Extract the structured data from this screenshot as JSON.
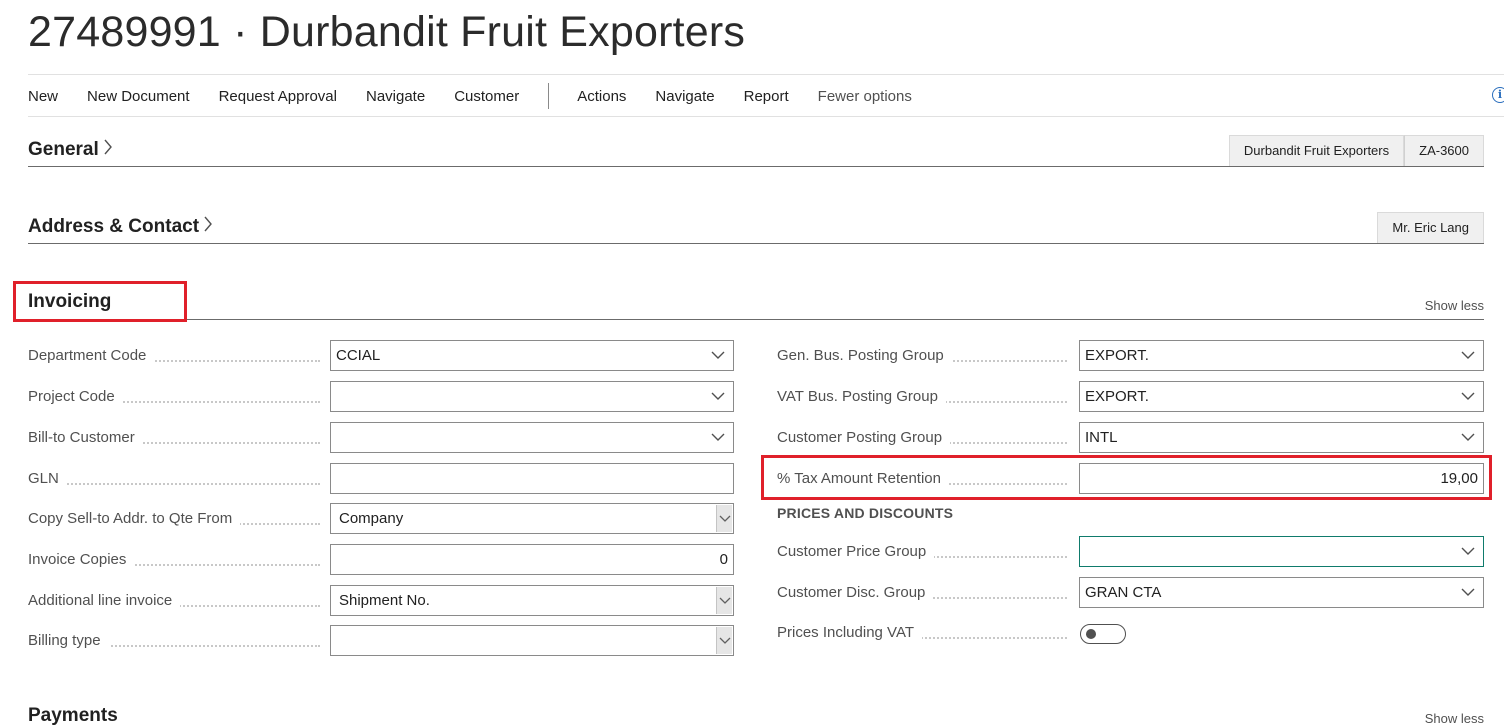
{
  "page": {
    "title": "27489991 · Durbandit Fruit Exporters"
  },
  "actions": [
    {
      "id": "new",
      "label": "New"
    },
    {
      "id": "new-document",
      "label": "New Document"
    },
    {
      "id": "request-approval",
      "label": "Request Approval"
    },
    {
      "id": "navigate",
      "label": "Navigate"
    },
    {
      "id": "customer",
      "label": "Customer"
    },
    {
      "id": "actions",
      "label": "Actions"
    },
    {
      "id": "navigate-2",
      "label": "Navigate"
    },
    {
      "id": "report",
      "label": "Report"
    },
    {
      "id": "fewer-options",
      "label": "Fewer options"
    }
  ],
  "sections": {
    "general": {
      "title": "General",
      "badges": [
        "Durbandit Fruit Exporters",
        "ZA-3600"
      ]
    },
    "address": {
      "title": "Address & Contact",
      "badges": [
        "Mr. Eric Lang"
      ]
    },
    "invoicing": {
      "title": "Invoicing",
      "show_less": "Show less"
    },
    "payments": {
      "title": "Payments",
      "show_less": "Show less"
    }
  },
  "invoicing": {
    "left": [
      {
        "label": "Department Code",
        "value": "CCIAL",
        "kind": "dropdown"
      },
      {
        "label": "Project Code",
        "value": "",
        "kind": "dropdown"
      },
      {
        "label": "Bill-to Customer",
        "value": "",
        "kind": "dropdown"
      },
      {
        "label": "GLN",
        "value": "",
        "kind": "text"
      },
      {
        "label": "Copy Sell-to Addr. to Qte From",
        "value": "Company",
        "kind": "select"
      },
      {
        "label": "Invoice Copies",
        "value": "0",
        "kind": "number"
      },
      {
        "label": "Additional line invoice",
        "value": "Shipment No.",
        "kind": "select"
      },
      {
        "label": "Billing type",
        "value": "",
        "kind": "select"
      }
    ],
    "right": [
      {
        "label": "Gen. Bus. Posting Group",
        "value": "EXPORT.",
        "kind": "dropdown"
      },
      {
        "label": "VAT Bus. Posting Group",
        "value": "EXPORT.",
        "kind": "dropdown"
      },
      {
        "label": "Customer Posting Group",
        "value": "INTL",
        "kind": "dropdown"
      },
      {
        "label": "% Tax Amount Retention",
        "value": "19,00",
        "kind": "number"
      }
    ],
    "prices_heading": "PRICES AND DISCOUNTS",
    "prices": [
      {
        "label": "Customer Price Group",
        "value": "",
        "kind": "dropdown"
      },
      {
        "label": "Customer Disc. Group",
        "value": "GRAN CTA",
        "kind": "dropdown"
      },
      {
        "label": "Prices Including VAT",
        "value": "",
        "kind": "toggle"
      }
    ]
  },
  "colors": {
    "highlight": "#e0202a",
    "focus": "#0f7b6c",
    "info": "#2a6ebd"
  }
}
